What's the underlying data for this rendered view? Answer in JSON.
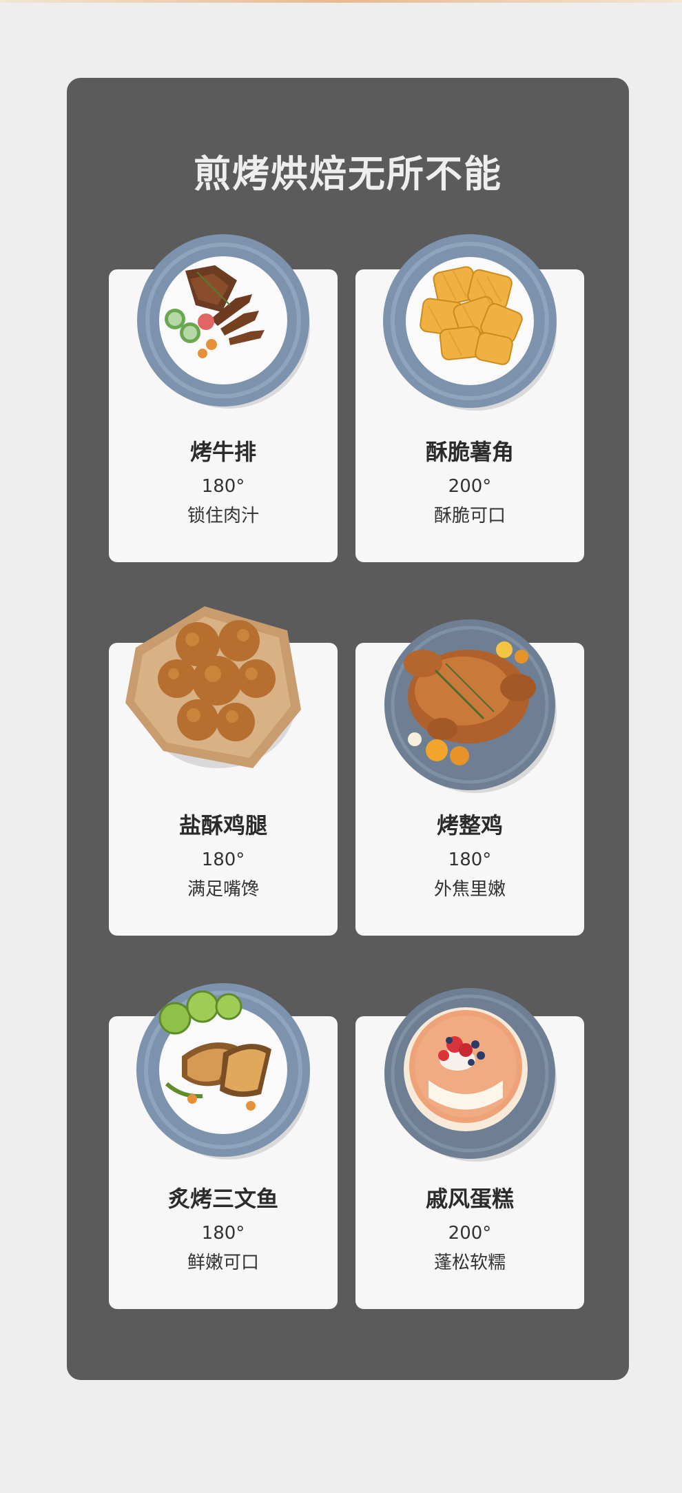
{
  "title": "煎烤烘焙无所不能",
  "dishes": [
    {
      "name": "烤牛排",
      "temperature": "180°",
      "description": "锁住肉汁",
      "image": "steak-plate"
    },
    {
      "name": "酥脆薯角",
      "temperature": "200°",
      "description": "酥脆可口",
      "image": "waffle-fries-plate"
    },
    {
      "name": "盐酥鸡腿",
      "temperature": "180°",
      "description": "满足嘴馋",
      "image": "fried-chicken-paper"
    },
    {
      "name": "烤整鸡",
      "temperature": "180°",
      "description": "外焦里嫩",
      "image": "roast-chicken-plate"
    },
    {
      "name": "炙烤三文鱼",
      "temperature": "180°",
      "description": "鲜嫩可口",
      "image": "grilled-salmon-plate"
    },
    {
      "name": "戚风蛋糕",
      "temperature": "200°",
      "description": "蓬松软糯",
      "image": "chiffon-cake-plate"
    }
  ],
  "colors": {
    "panel": "#5b5b5b",
    "card": "#f7f7f7",
    "page": "#eeeeee",
    "plate": "#7d93ad"
  }
}
